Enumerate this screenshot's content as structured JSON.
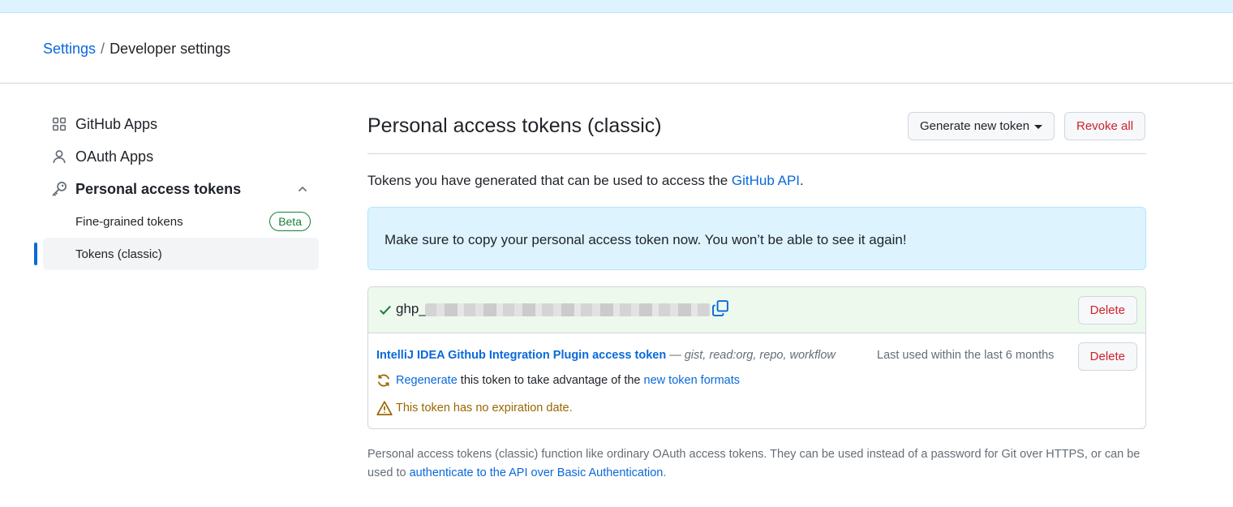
{
  "breadcrumb": {
    "root": "Settings",
    "separator": "/",
    "current": "Developer settings"
  },
  "sidebar": {
    "items": [
      {
        "label": "GitHub Apps",
        "icon": "apps-grid-icon"
      },
      {
        "label": "OAuth Apps",
        "icon": "person-icon"
      },
      {
        "label": "Personal access tokens",
        "icon": "key-icon",
        "expanded": true
      }
    ],
    "subitems": [
      {
        "label": "Fine-grained tokens",
        "badge": "Beta"
      },
      {
        "label": "Tokens (classic)",
        "active": true
      }
    ]
  },
  "main": {
    "title": "Personal access tokens (classic)",
    "generate_button": "Generate new token",
    "revoke_button": "Revoke all",
    "intro_text": "Tokens you have generated that can be used to access the ",
    "intro_link": "GitHub API",
    "intro_end": ".",
    "flash": "Make sure to copy your personal access token now. You won’t be able to see it again!",
    "new_token": {
      "prefix": "ghp_",
      "delete_label": "Delete"
    },
    "token": {
      "name": "IntelliJ IDEA Github Integration Plugin access token",
      "scopes": " — gist, read:org, repo, workflow",
      "last_used": "Last used within the last 6 months",
      "delete_label": "Delete",
      "regen_link": "Regenerate",
      "regen_text": " this token to take advantage of the ",
      "regen_link2": "new token formats",
      "warning": "This token has no expiration date."
    },
    "footnote_text": "Personal access tokens (classic) function like ordinary OAuth access tokens. They can be used instead of a password for Git over HTTPS, or can be used to ",
    "footnote_link": "authenticate to the API over Basic Authentication",
    "footnote_end": "."
  },
  "colors": {
    "accent": "#0969da",
    "danger": "#cf222e",
    "success": "#1a7f37",
    "attention": "#9a6700",
    "flash_bg": "#ddf4ff"
  }
}
